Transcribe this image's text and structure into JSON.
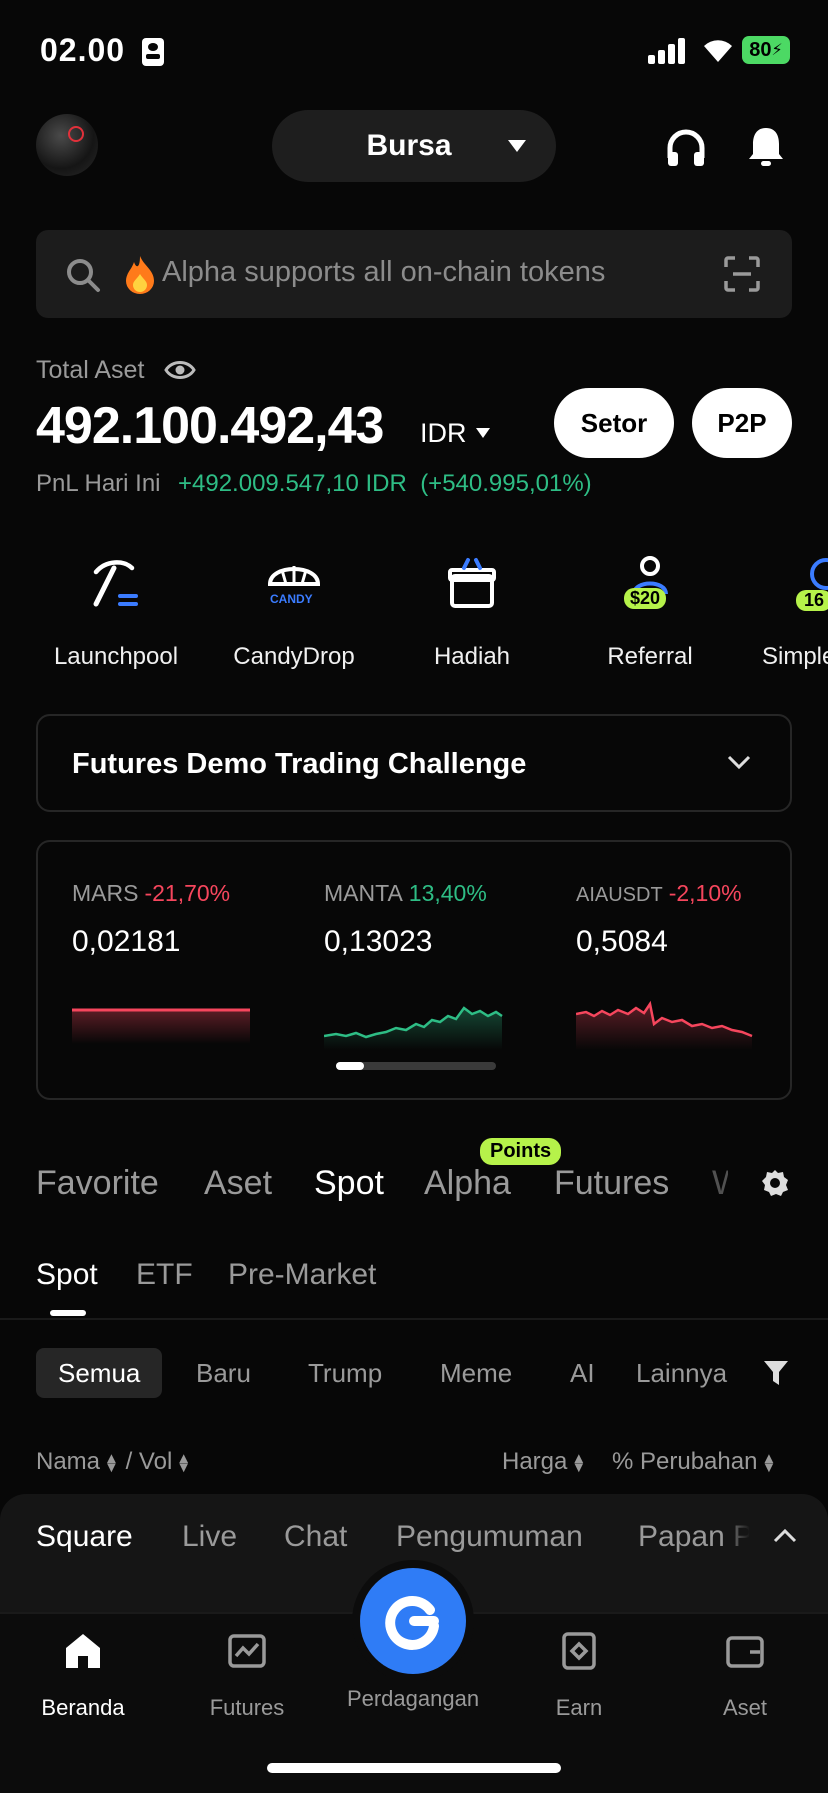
{
  "status": {
    "time": "02.00",
    "battery": "80"
  },
  "header": {
    "exchange_label": "Bursa"
  },
  "search": {
    "placeholder": "Alpha supports all on-chain tokens"
  },
  "assets": {
    "label": "Total Aset",
    "value": "492.100.492,43",
    "currency": "IDR",
    "deposit_label": "Setor",
    "p2p_label": "P2P",
    "pnl_label": "PnL Hari Ini",
    "pnl_value": "+492.009.547,10 IDR",
    "pnl_pct": "(+540.995,01%)"
  },
  "shortcuts": [
    {
      "label": "Launchpool",
      "icon": "pickaxe-icon"
    },
    {
      "label": "CandyDrop",
      "icon": "candy-parachute-icon",
      "badge": "CANDY"
    },
    {
      "label": "Hadiah",
      "icon": "gift-icon"
    },
    {
      "label": "Referral",
      "icon": "referral-icon",
      "badge": "$20"
    },
    {
      "label": "Simple",
      "icon": "simple-earn-icon",
      "badge": "16"
    }
  ],
  "challenge": {
    "title": "Futures Demo Trading Challenge"
  },
  "tickers": [
    {
      "symbol": "MARS",
      "change": "-21,70%",
      "price": "0,02181",
      "trend": "down"
    },
    {
      "symbol": "MANTA",
      "change": "13,40%",
      "price": "0,13023",
      "trend": "up"
    },
    {
      "symbol": "AIAUSDT",
      "change": "-2,10%",
      "price": "0,5084",
      "trend": "down"
    }
  ],
  "market_tabs": [
    "Favorite",
    "Aset",
    "Spot",
    "Alpha",
    "Futures",
    "W"
  ],
  "market_tab_active": "Spot",
  "points_badge": "Points",
  "sub_tabs": [
    "Spot",
    "ETF",
    "Pre-Market"
  ],
  "filters": [
    "Semua",
    "Baru",
    "Trump",
    "Meme",
    "AI",
    "Lainnya"
  ],
  "columns": {
    "name": "Nama",
    "sep": "/",
    "vol": "Vol",
    "price": "Harga",
    "change": "% Perubahan"
  },
  "square_tabs": [
    "Square",
    "Live",
    "Chat",
    "Pengumuman",
    "Papan P"
  ],
  "nav": [
    {
      "label": "Beranda",
      "icon": "home-icon"
    },
    {
      "label": "Futures",
      "icon": "futures-chart-icon"
    },
    {
      "label": "Perdagangan",
      "icon": "trade-icon"
    },
    {
      "label": "Earn",
      "icon": "earn-icon"
    },
    {
      "label": "Aset",
      "icon": "wallet-icon"
    }
  ],
  "colors": {
    "up": "#2ebd85",
    "down": "#f6465d",
    "accent": "#2f7cf6",
    "badge": "#b6f24a"
  }
}
